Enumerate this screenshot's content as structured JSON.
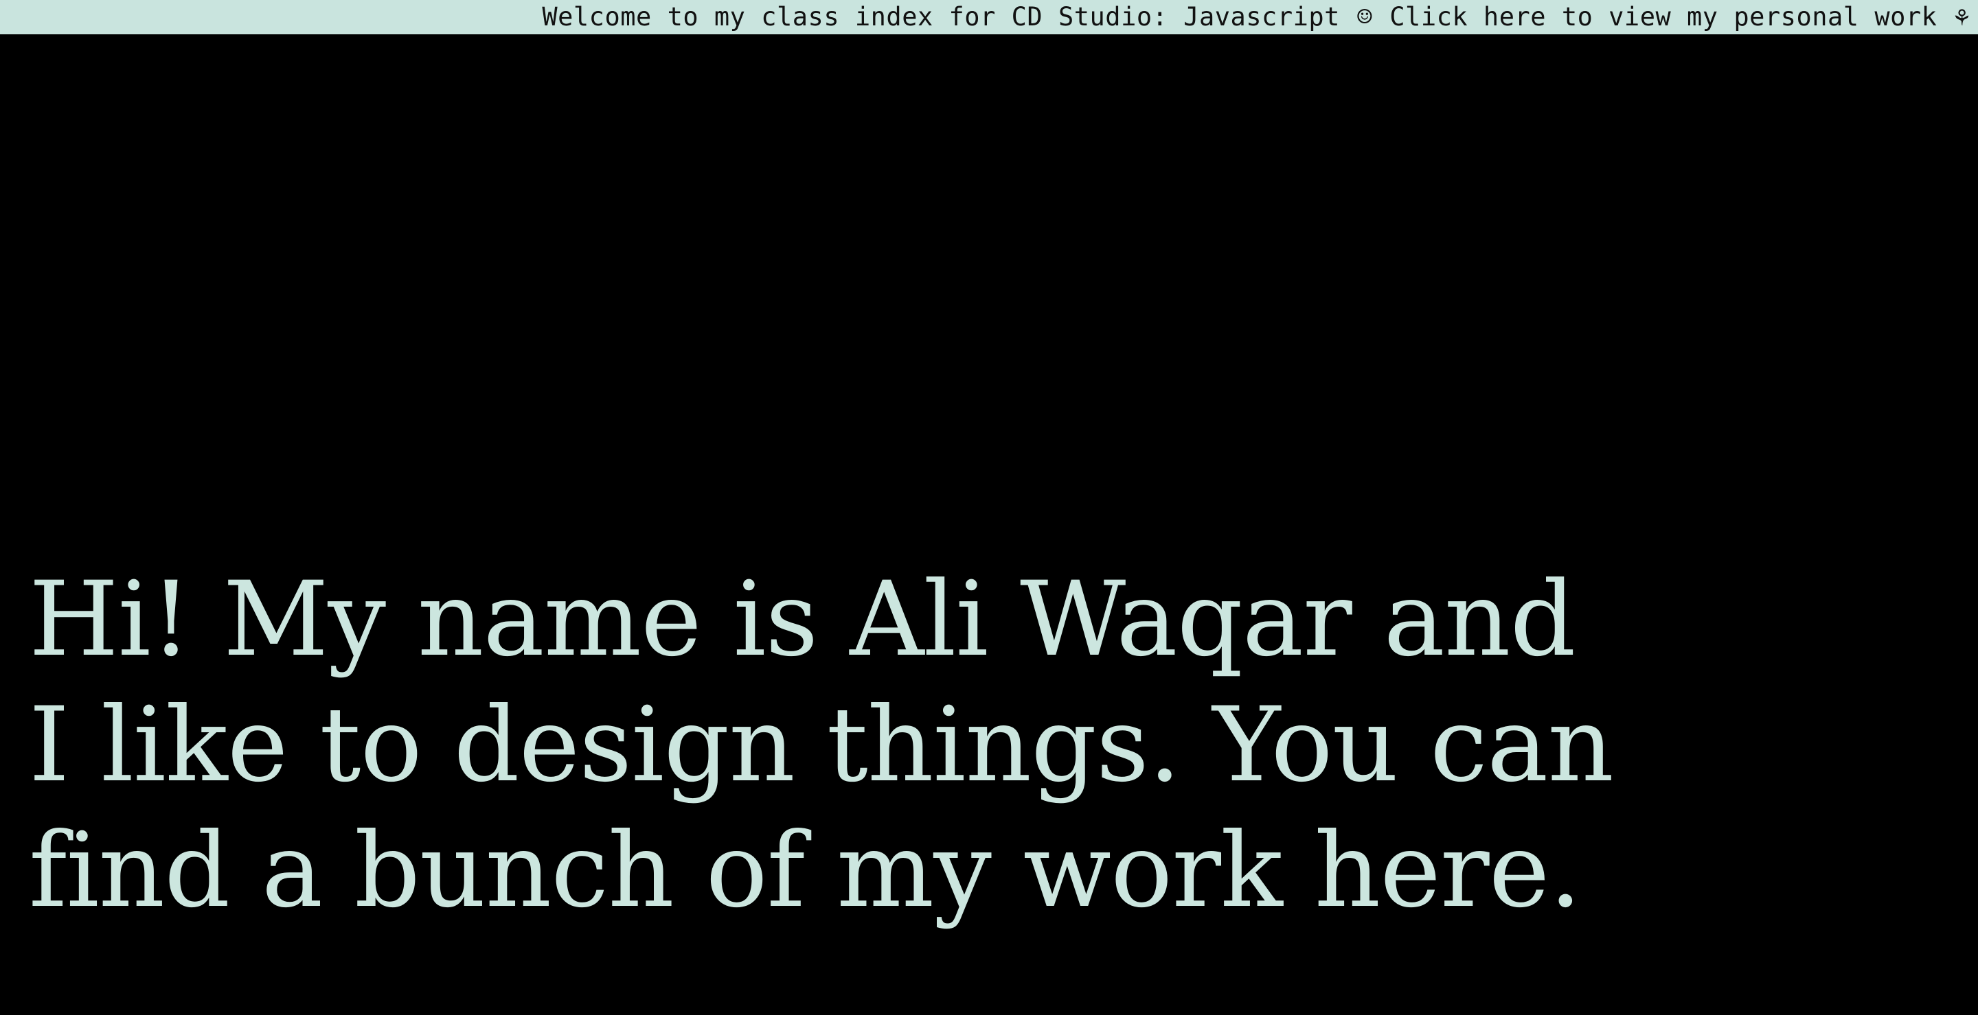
{
  "ticker": {
    "welcome_text": "Welcome to my class index for CD Studio: Javascript",
    "smiley_icon": "☺",
    "personal_work_link": "Click here to view my personal work",
    "flower_icon": "⚘"
  },
  "intro": {
    "line1": "Hi! My name is Ali Waqar and",
    "line2": "I like to design things. You can",
    "line3": "find a bunch of my work here."
  },
  "colors": {
    "background": "#000000",
    "ticker_background": "#c9e4de",
    "text_accent": "#cce6df"
  }
}
